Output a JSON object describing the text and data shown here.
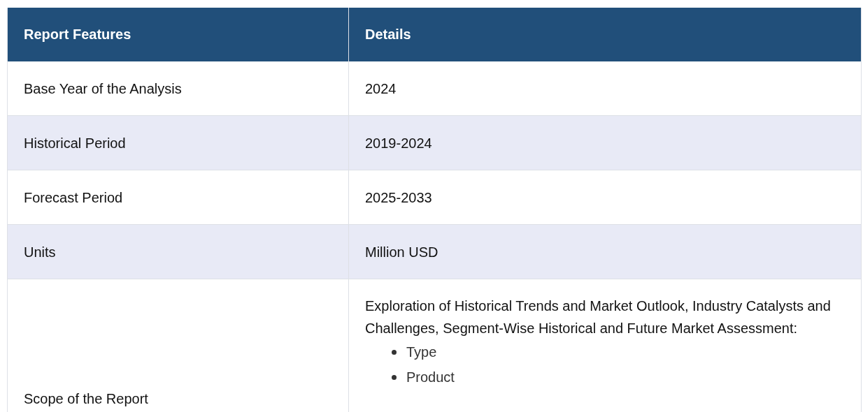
{
  "table": {
    "columns": [
      "Report Features",
      "Details"
    ],
    "rows": [
      {
        "feature": "Base Year of the Analysis",
        "details": "2024"
      },
      {
        "feature": "Historical Period",
        "details": "2019-2024"
      },
      {
        "feature": "Forecast Period",
        "details": "2025-2033"
      },
      {
        "feature": "Units",
        "details": "Million USD"
      },
      {
        "feature": "Scope of the Report",
        "details": "Exploration of Historical Trends and Market Outlook, Industry Catalysts and Challenges, Segment-Wise Historical and Future Market Assessment:",
        "bullets": [
          "Type",
          "Product"
        ]
      }
    ]
  }
}
